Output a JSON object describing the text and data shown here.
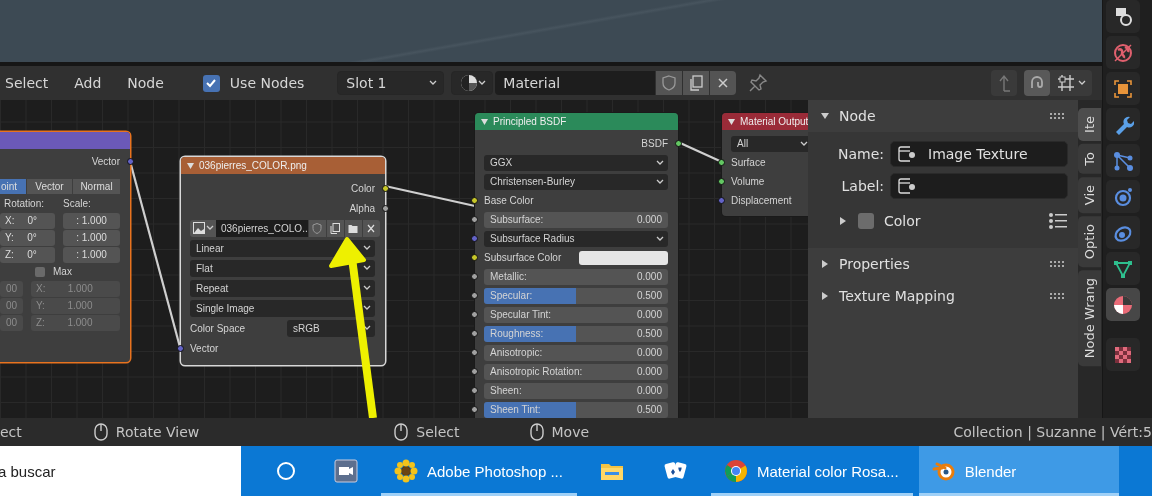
{
  "properties_tabs": [
    {
      "kind": "camera",
      "selected": false
    },
    {
      "kind": "world",
      "selected": false
    },
    {
      "kind": "object",
      "selected": false
    },
    {
      "kind": "modifiers",
      "selected": false
    },
    {
      "kind": "particles",
      "selected": false
    },
    {
      "kind": "physics",
      "selected": false
    },
    {
      "kind": "constraints",
      "selected": false
    },
    {
      "kind": "data",
      "selected": false
    },
    {
      "kind": "material",
      "selected": true
    },
    {
      "kind": "texture",
      "selected": false
    }
  ],
  "header": {
    "menus": [
      "Select",
      "Add",
      "Node"
    ],
    "use_nodes": {
      "label": "Use Nodes",
      "checked": true
    },
    "slot": "Slot 1",
    "material": "Material"
  },
  "nodes": [
    {
      "kind": "mapping",
      "color": "#6b59b8",
      "rows": [
        {
          "kind": "output",
          "label": "Vector",
          "color": "#6363c7"
        },
        {
          "kind": "tabs",
          "items": [
            {
              "label": "oint",
              "selected": true
            },
            {
              "label": "Vector",
              "selected": false
            },
            {
              "label": "Normal",
              "selected": false
            }
          ]
        },
        {
          "kind": "labels",
          "items": [
            "Rotation:",
            "Scale:"
          ]
        },
        {
          "kind": "pair",
          "disabled": false,
          "cells": [
            {
              "label": "X:",
              "value": "0°"
            },
            {
              "value": ": 1.000"
            }
          ]
        },
        {
          "kind": "pair",
          "disabled": false,
          "cells": [
            {
              "label": "Y:",
              "value": "0°"
            },
            {
              "value": ": 1.000"
            }
          ]
        },
        {
          "kind": "pair",
          "disabled": false,
          "cells": [
            {
              "label": "Z:",
              "value": "0°"
            },
            {
              "value": ": 1.000"
            }
          ]
        },
        {
          "kind": "checkbox",
          "label": "Max",
          "checked": false
        },
        {
          "kind": "pair",
          "disabled": true,
          "cells": [
            {
              "value": "00"
            },
            {
              "label": "X:",
              "value": "1.000"
            }
          ]
        },
        {
          "kind": "pair",
          "disabled": true,
          "cells": [
            {
              "value": "00"
            },
            {
              "label": "Y:",
              "value": "1.000"
            }
          ]
        },
        {
          "kind": "pair",
          "disabled": true,
          "cells": [
            {
              "value": "00"
            },
            {
              "label": "Z:",
              "value": "1.000"
            }
          ]
        }
      ]
    },
    {
      "kind": "image_texture",
      "color": "#a85f36",
      "title": "036pierres_COLOR.png",
      "rows": [
        {
          "kind": "output",
          "label": "Color",
          "color": "#c7c729"
        },
        {
          "kind": "output",
          "label": "Alpha",
          "color": "#a1a1a1"
        },
        {
          "kind": "image",
          "value": "036pierres_COLO.."
        },
        {
          "kind": "dropdown",
          "value": "Linear"
        },
        {
          "kind": "dropdown",
          "value": "Flat"
        },
        {
          "kind": "dropdown",
          "value": "Repeat"
        },
        {
          "kind": "dropdown",
          "value": "Single Image"
        },
        {
          "kind": "dropdown",
          "label": "Color Space",
          "value": "sRGB"
        },
        {
          "kind": "input",
          "label": "Vector",
          "color": "#6363c7"
        }
      ]
    },
    {
      "kind": "principled",
      "color": "#2b8a5a",
      "title": "Principled BSDF",
      "rows": [
        {
          "kind": "output",
          "label": "BSDF",
          "color": "#63c763"
        },
        {
          "kind": "dropdown",
          "value": "GGX"
        },
        {
          "kind": "dropdown",
          "value": "Christensen-Burley"
        },
        {
          "kind": "input",
          "label": "Base Color",
          "color": "#c7c729"
        },
        {
          "kind": "slider",
          "label": "Subsurface:",
          "value": "0.000",
          "level": 0,
          "color": "#a1a1a1"
        },
        {
          "kind": "dropdown",
          "value": "Subsurface Radius",
          "color": "#6363c7"
        },
        {
          "kind": "color",
          "label": "Subsurface Color",
          "color": "#c7c729"
        },
        {
          "kind": "slider",
          "label": "Metallic:",
          "value": "0.000",
          "level": 0,
          "color": "#a1a1a1"
        },
        {
          "kind": "slider",
          "label": "Specular:",
          "value": "0.500",
          "level": 0.5,
          "color": "#a1a1a1"
        },
        {
          "kind": "slider",
          "label": "Specular Tint:",
          "value": "0.000",
          "level": 0,
          "color": "#a1a1a1"
        },
        {
          "kind": "slider",
          "label": "Roughness:",
          "value": "0.500",
          "level": 0.5,
          "color": "#a1a1a1"
        },
        {
          "kind": "slider",
          "label": "Anisotropic:",
          "value": "0.000",
          "level": 0,
          "color": "#a1a1a1"
        },
        {
          "kind": "slider",
          "label": "Anisotropic Rotation:",
          "value": "0.000",
          "level": 0,
          "color": "#a1a1a1"
        },
        {
          "kind": "slider",
          "label": "Sheen:",
          "value": "0.000",
          "level": 0,
          "color": "#a1a1a1"
        },
        {
          "kind": "slider",
          "label": "Sheen Tint:",
          "value": "0.500",
          "level": 0.5,
          "color": "#a1a1a1"
        }
      ]
    },
    {
      "kind": "output",
      "color": "#9a2b38",
      "title": "Material Output",
      "rows": [
        {
          "kind": "dropdown",
          "value": "All"
        },
        {
          "kind": "input",
          "label": "Surface",
          "color": "#63c763"
        },
        {
          "kind": "input",
          "label": "Volume",
          "color": "#63c763"
        },
        {
          "kind": "input",
          "label": "Displacement",
          "color": "#6363c7"
        }
      ]
    }
  ],
  "sidebar": {
    "panels": [
      {
        "title": "Node",
        "expanded": true,
        "fields": [
          {
            "label": "Name:",
            "value": "Image Texture"
          },
          {
            "label": "Label:"
          }
        ],
        "subpanel": {
          "label": "Color",
          "expanded": false,
          "checked": false
        }
      },
      {
        "title": "Properties",
        "expanded": false
      },
      {
        "title": "Texture Mapping",
        "expanded": false
      }
    ],
    "tabs": [
      {
        "label": "Ite",
        "selected": true
      },
      {
        "label": "To",
        "selected": false
      },
      {
        "label": "Vie",
        "selected": false
      },
      {
        "label": "Optio",
        "selected": false
      },
      {
        "label": "Node Wrang",
        "selected": false
      }
    ]
  },
  "status_bar": {
    "left": "ect",
    "hints": [
      "Rotate View",
      "Select",
      "Move"
    ],
    "right": "Collection | Suzanne | Vért:5"
  },
  "taskbar": {
    "search": {
      "placeholder": "a buscar"
    },
    "apps": [
      {
        "kind": "cortana",
        "open": false,
        "selected": false
      },
      {
        "kind": "camera",
        "open": false,
        "selected": false
      },
      {
        "kind": "photoshop",
        "label": "Adobe Photoshop ...",
        "open": true,
        "selected": false
      },
      {
        "kind": "explorer",
        "open": false,
        "selected": false
      },
      {
        "kind": "cards",
        "open": false,
        "selected": false
      },
      {
        "kind": "chrome",
        "label": "Material color Rosa...",
        "open": true,
        "selected": false
      },
      {
        "kind": "blender",
        "label": "Blender",
        "open": true,
        "selected": true
      }
    ]
  }
}
